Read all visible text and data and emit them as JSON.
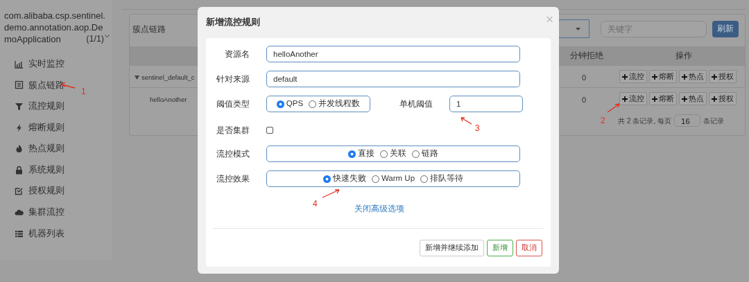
{
  "sidebar": {
    "app_name": "com.alibaba.csp.sentinel.demo.annotation.aop.DemoApplication",
    "instance_count": "(1/1)",
    "items": [
      {
        "label": "实时监控",
        "selected": false
      },
      {
        "label": "簇点链路",
        "selected": false
      },
      {
        "label": "流控规则",
        "selected": false
      },
      {
        "label": "熔断规则",
        "selected": false
      },
      {
        "label": "热点规则",
        "selected": false
      },
      {
        "label": "系统规则",
        "selected": false
      },
      {
        "label": "授权规则",
        "selected": false
      },
      {
        "label": "集群流控",
        "selected": false
      },
      {
        "label": "机器列表",
        "selected": false
      }
    ]
  },
  "panel": {
    "title": "簇点链路",
    "search": {
      "placeholder": "关键字"
    },
    "refresh_button": "刷新",
    "table": {
      "columns": [
        "分钟拒绝",
        "操作"
      ],
      "rows": [
        {
          "name": "sentinel_default_c",
          "expanded": true,
          "rejected": "0",
          "actions": [
            "流控",
            "熔断",
            "热点",
            "授权"
          ],
          "children": [
            {
              "name": "helloAnother",
              "rejected": "0",
              "actions": [
                "流控",
                "熔断",
                "热点",
                "授权"
              ]
            }
          ]
        }
      ]
    },
    "pagination": {
      "prefix": "共 2 条记录, 每页",
      "page_size": "16",
      "suffix": "条记录"
    }
  },
  "dialog": {
    "title": "新增流控规则",
    "close": "×",
    "resource": {
      "label": "资源名",
      "value": "helloAnother"
    },
    "origin": {
      "label": "针对来源",
      "value": "default"
    },
    "threshold_type": {
      "label": "阈值类型",
      "options": [
        {
          "label": "QPS",
          "selected": true
        },
        {
          "label": "并发线程数",
          "selected": false
        }
      ]
    },
    "threshold": {
      "label": "单机阈值",
      "value": "1"
    },
    "cluster": {
      "label": "是否集群",
      "checked": false
    },
    "mode": {
      "label": "流控模式",
      "options": [
        {
          "label": "直接",
          "selected": true
        },
        {
          "label": "关联",
          "selected": false
        },
        {
          "label": "链路",
          "selected": false
        }
      ]
    },
    "effect": {
      "label": "流控效果",
      "options": [
        {
          "label": "快速失败",
          "selected": true
        },
        {
          "label": "Warm Up",
          "selected": false
        },
        {
          "label": "排队等待",
          "selected": false
        }
      ]
    },
    "advanced_link": "关闭高级选项",
    "buttons": [
      {
        "label": "新增并继续添加",
        "kind": "default"
      },
      {
        "label": "新增",
        "kind": "confirm"
      },
      {
        "label": "取消",
        "kind": "cancel"
      }
    ]
  },
  "annotations": [
    {
      "label": "1"
    },
    {
      "label": "2"
    },
    {
      "label": "3"
    },
    {
      "label": "4"
    }
  ]
}
